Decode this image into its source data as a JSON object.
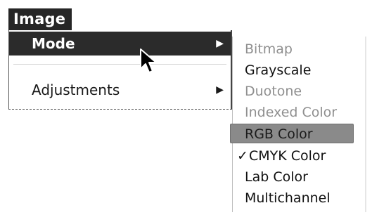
{
  "menubar": {
    "title": "Image"
  },
  "menu": {
    "items": [
      {
        "label": "Mode",
        "arrow": "▶",
        "selected": true
      },
      {
        "label": "Adjustments",
        "arrow": "▶",
        "selected": false
      }
    ]
  },
  "submenu": {
    "items": [
      {
        "label": "Bitmap",
        "state": "disabled",
        "check": ""
      },
      {
        "label": "Grayscale",
        "state": "enabled",
        "check": ""
      },
      {
        "label": "Duotone",
        "state": "disabled",
        "check": ""
      },
      {
        "label": "Indexed Color",
        "state": "disabled",
        "check": ""
      },
      {
        "label": "RGB Color",
        "state": "highlighted",
        "check": ""
      },
      {
        "label": "CMYK Color",
        "state": "enabled",
        "check": "✓"
      },
      {
        "label": "Lab Color",
        "state": "enabled",
        "check": ""
      },
      {
        "label": "Multichannel",
        "state": "enabled",
        "check": ""
      }
    ]
  },
  "colors": {
    "selection": "#2b2b2b",
    "highlight": "#8a8a8a",
    "disabled_text": "#8f8f8f"
  }
}
